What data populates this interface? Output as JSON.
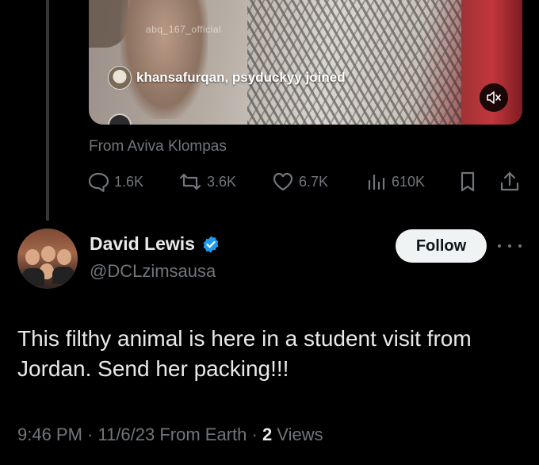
{
  "media": {
    "user_tag": "abq_167_official",
    "joined_text": "khansafurqan, psyduckyy joined",
    "mute_icon": "speaker-muted-icon"
  },
  "quoted_tweet": {
    "from_text": "From Aviva Klompas"
  },
  "actions": {
    "replies": "1.6K",
    "reposts": "3.6K",
    "likes": "6.7K",
    "views": "610K"
  },
  "author": {
    "name": "David Lewis",
    "handle": "@DCLzimsausa",
    "verified": true,
    "verified_color": "#1d9bf0"
  },
  "follow_label": "Follow",
  "tweet": {
    "text": "This filthy animal is here in a student visit from Jordan.  Send her packing!!!",
    "meta_prefix": "9:46 PM · 11/6/23 From Earth · ",
    "view_count": "2",
    "views_label": " Views"
  },
  "colors": {
    "background": "#000000",
    "secondary_text": "#71767b",
    "primary_text": "#e7e9ea",
    "accent": "#1d9bf0"
  }
}
